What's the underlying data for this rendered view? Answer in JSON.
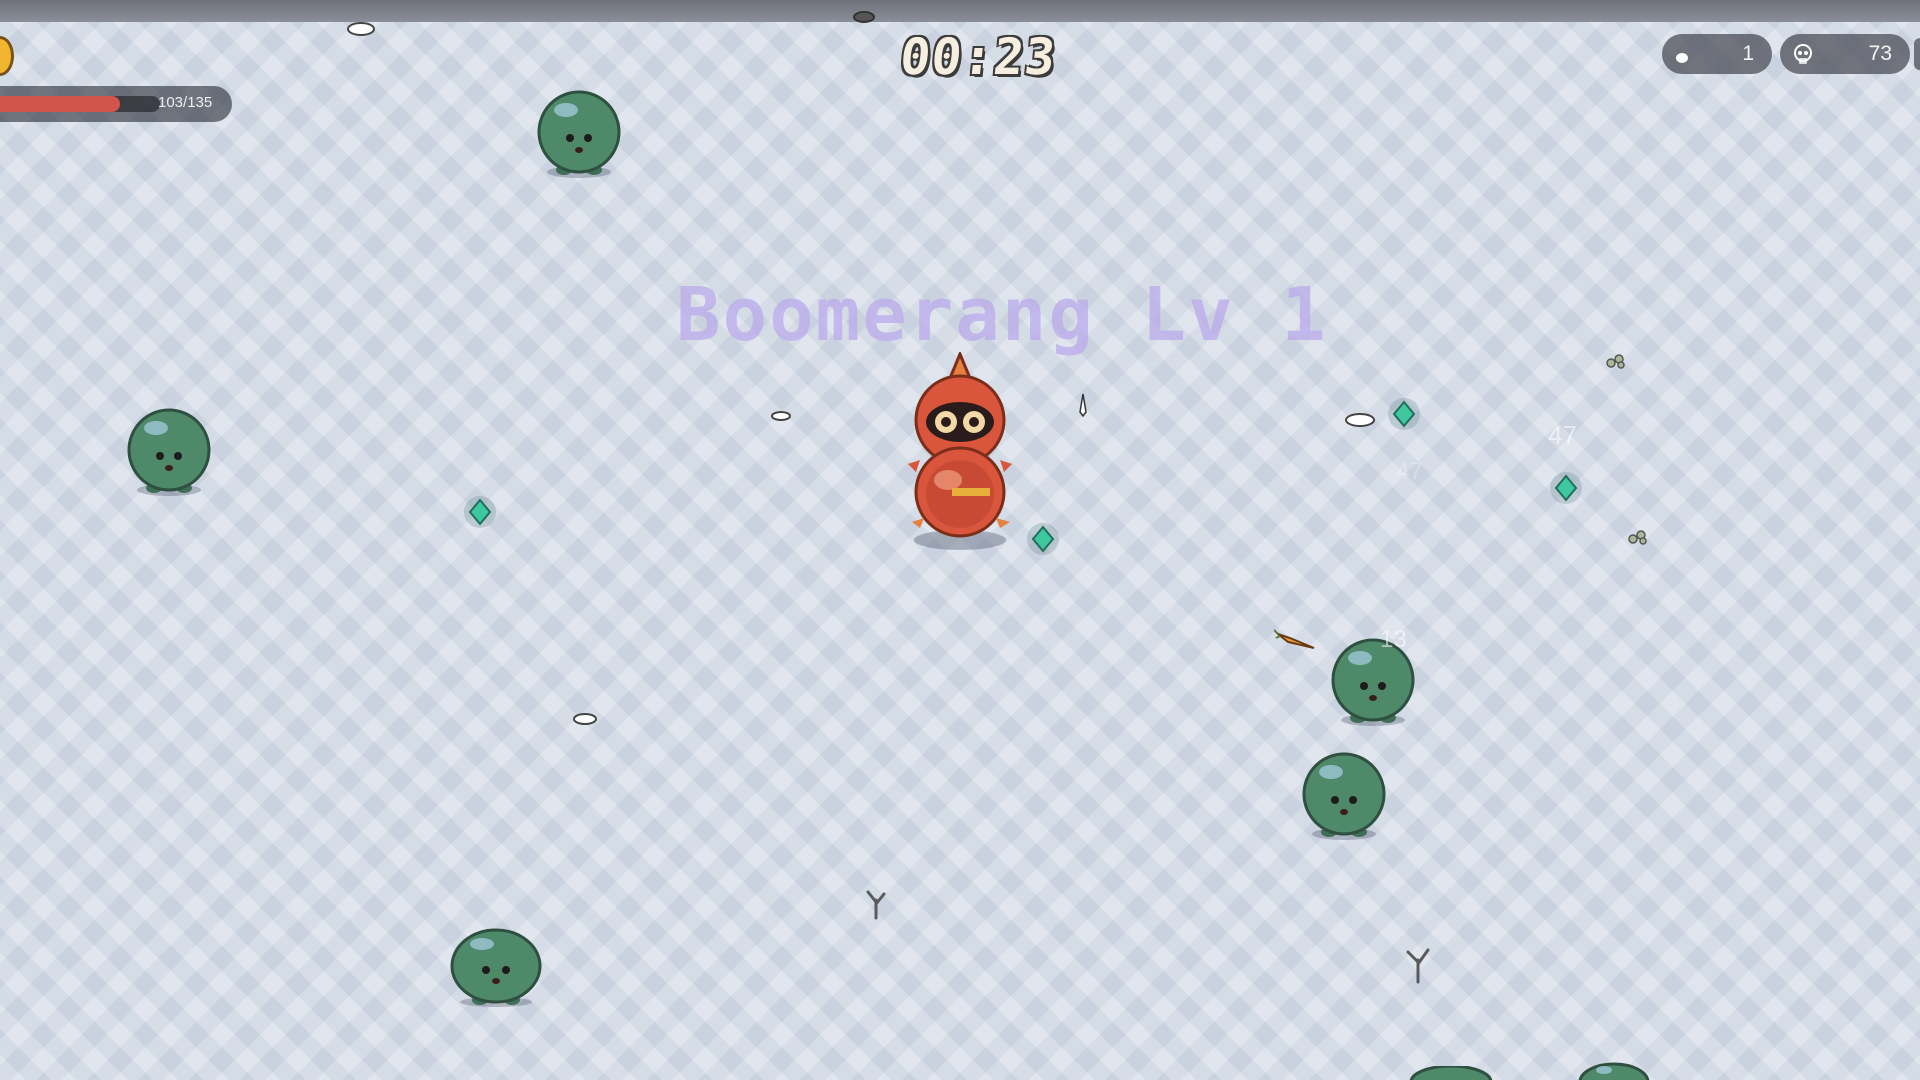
{
  "hud": {
    "timer": "00:23",
    "health": {
      "current": 103,
      "max": 135,
      "text": "103/135",
      "fraction": 0.763
    },
    "level_counter": {
      "icon": "egg-icon",
      "value": "1"
    },
    "kill_counter": {
      "icon": "skull-icon",
      "value": "73"
    }
  },
  "banner": {
    "text": "Boomerang Lv 1"
  },
  "damage_numbers": [
    "47",
    "47",
    "13"
  ],
  "colors": {
    "health_fill": "#d2544a",
    "slime_body": "#4e8a6a",
    "gem": "#3fc7a0",
    "player": "#d9553b",
    "banner": "#b9aaeb"
  }
}
